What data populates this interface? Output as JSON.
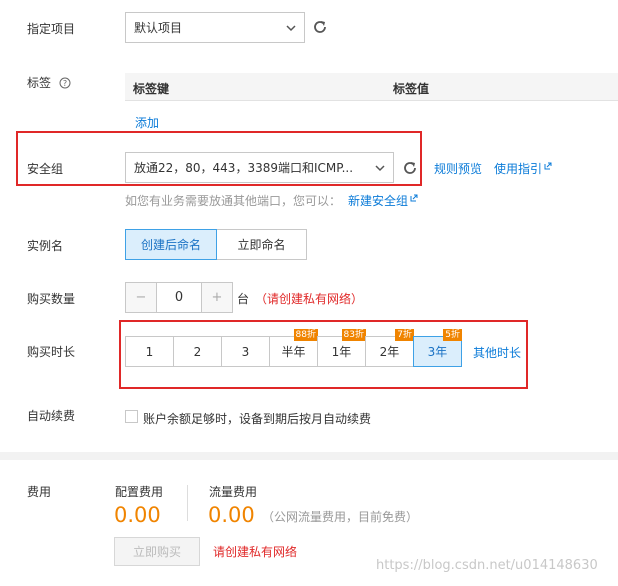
{
  "project": {
    "label": "指定项目",
    "selected": "默认项目"
  },
  "tags": {
    "label": "标签",
    "key_header": "标签键",
    "value_header": "标签值",
    "add_link": "添加"
  },
  "security_group": {
    "label": "安全组",
    "selected": "放通22，80，443，3389端口和ICMP...",
    "rule_preview": "规则预览",
    "usage_guide": "使用指引",
    "hint": "如您有业务需要放通其他端口，您可以：",
    "create_link": "新建安全组"
  },
  "instance_name": {
    "label": "实例名",
    "options": [
      "创建后命名",
      "立即命名"
    ],
    "selected": "创建后命名"
  },
  "quantity": {
    "label": "购买数量",
    "minus": "−",
    "value": "0",
    "plus": "+",
    "unit": "台",
    "warning": "（请创建私有网络）"
  },
  "duration": {
    "label": "购买时长",
    "options": [
      {
        "label": "1",
        "badge": ""
      },
      {
        "label": "2",
        "badge": ""
      },
      {
        "label": "3",
        "badge": ""
      },
      {
        "label": "半年",
        "badge": "88折"
      },
      {
        "label": "1年",
        "badge": "83折"
      },
      {
        "label": "2年",
        "badge": "7折"
      },
      {
        "label": "3年",
        "badge": "5折"
      }
    ],
    "selected": "3年",
    "other_link": "其他时长"
  },
  "auto_renew": {
    "label": "自动续费",
    "text": "账户余额足够时，设备到期后按月自动续费",
    "checked": false
  },
  "fee": {
    "label": "费用",
    "config_label": "配置费用",
    "config_value": "0.00",
    "traffic_label": "流量费用",
    "traffic_value": "0.00",
    "traffic_note": "（公网流量费用，目前免费）"
  },
  "buy_button": "立即购买",
  "buy_warning": "请创建私有网络",
  "watermark": "https://blog.csdn.net/u014148630",
  "colors": {
    "accent": "#0b7bd8",
    "price": "#f08400",
    "highlight_border": "#e02828",
    "warning_text": "#e02828"
  }
}
